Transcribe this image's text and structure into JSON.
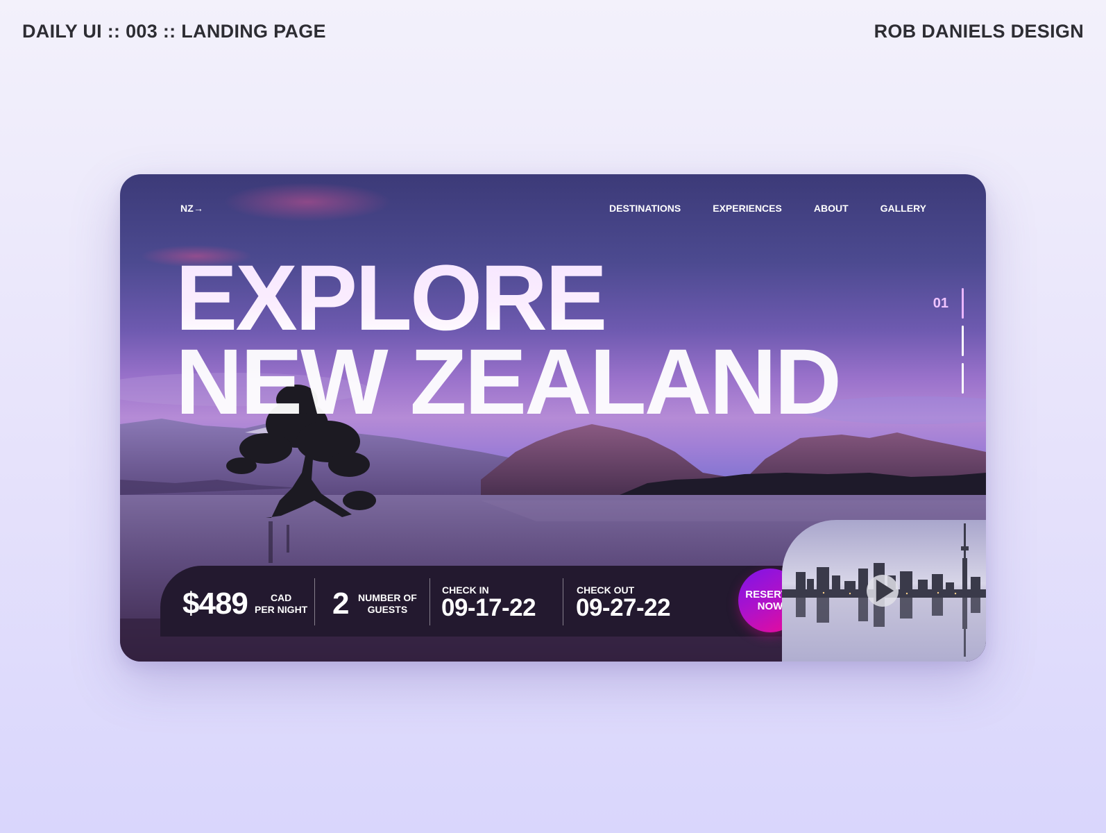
{
  "shot": {
    "title": "DAILY UI :: 003 :: LANDING PAGE",
    "credit": "ROB DANIELS DESIGN"
  },
  "nav": {
    "logo": "NZ→",
    "items": [
      "DESTINATIONS",
      "EXPERIENCES",
      "ABOUT",
      "GALLERY"
    ]
  },
  "hero": {
    "line1": "EXPLORE",
    "line2": "NEW ZEALAND"
  },
  "slider": {
    "current": "01"
  },
  "booking": {
    "price": "$489",
    "price_unit_line1": "CAD",
    "price_unit_line2": "PER NIGHT",
    "guests": "2",
    "guests_label_line1": "NUMBER OF",
    "guests_label_line2": "GUESTS",
    "checkin_label": "CHECK IN",
    "checkin_value": "09-17-22",
    "checkout_label": "CHECK OUT",
    "checkout_value": "09-27-22",
    "reserve_line1": "RESERVE",
    "reserve_line2": "NOW"
  },
  "icons": {
    "play": "play-icon"
  },
  "colors": {
    "accent_purple": "#7d14e8",
    "accent_pink": "#ee0a95",
    "booking_bg": "#23192f"
  }
}
